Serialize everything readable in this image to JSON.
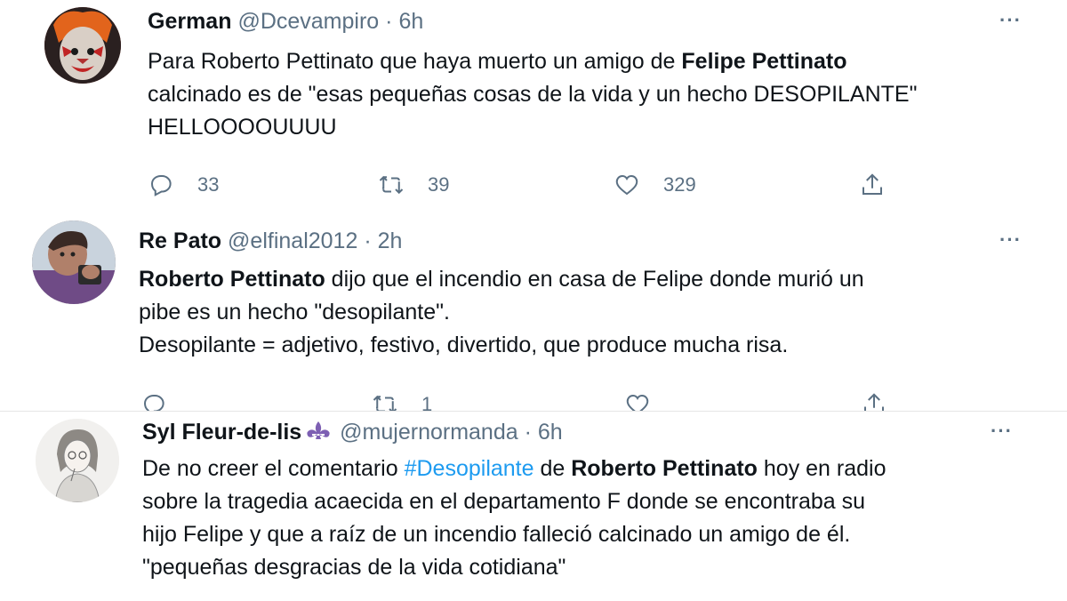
{
  "tweets": [
    {
      "name": "German",
      "handle": "@Dcevampiro",
      "sep": "·",
      "time": "6h",
      "more": "···",
      "lines": [
        [
          "Para Roberto Pettinato que haya muerto un amigo de ",
          "Felipe Pettinato"
        ],
        [
          "calcinado es de \"esas pequeñas cosas de la vida y un hecho DESOPILANTE\""
        ],
        [
          "HELLOOOOUUUU"
        ]
      ],
      "replies": "33",
      "retweets": "39",
      "likes": "329"
    },
    {
      "name": "Re Pato",
      "handle": "@elfinal2012",
      "sep": "·",
      "time": "2h",
      "more": "···",
      "line1_bold": "Roberto Pettinato",
      "line1_rest": " dijo que el incendio en casa de Felipe donde murió un",
      "line2": "pibe es un hecho \"desopilante\".",
      "line3": "Desopilante =  adjetivo, festivo, divertido, que produce mucha risa.",
      "retweets": "1"
    },
    {
      "name": "Syl Fleur-de-lis",
      "handle": "@mujernormanda",
      "sep": "·",
      "time": "6h",
      "more": "···",
      "line1_a": "De no creer el comentario ",
      "line1_tag": "#Desopilante",
      "line1_b": " de ",
      "line1_bold": "Roberto Pettinato",
      "line1_c": " hoy en radio",
      "line2": "sobre la tragedia acaecida en el departamento F donde se encontraba su",
      "line3": "hijo Felipe y que a raíz de un incendio falleció calcinado un amigo de él.",
      "line4": "\"pequeñas desgracias de la vida cotidiana\""
    }
  ],
  "colors": {
    "text": "#0f1419",
    "muted": "#5b7083",
    "link": "#1d9bf0"
  },
  "icons": [
    "reply-icon",
    "retweet-icon",
    "like-icon",
    "share-icon",
    "more-icon",
    "fleur-de-lis-icon"
  ]
}
